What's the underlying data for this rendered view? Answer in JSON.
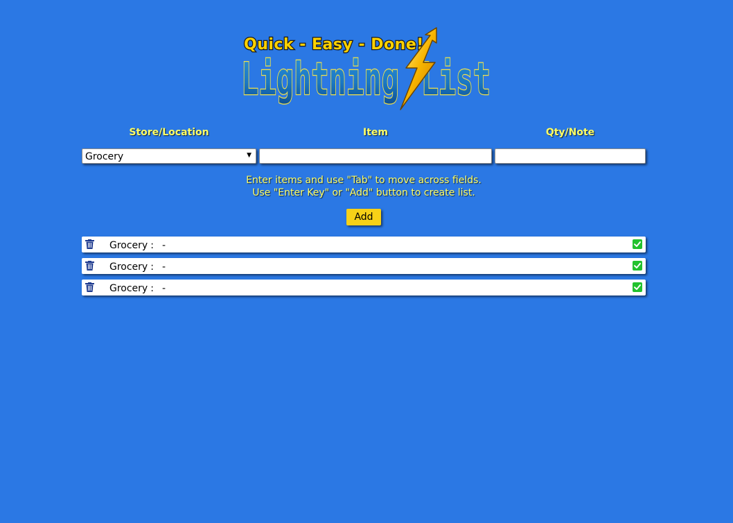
{
  "logo": {
    "tagline": "Quick - Easy - Done!",
    "name_part1": "Lightning",
    "name_part2": "List",
    "icon": "lightning-bolt-icon"
  },
  "form": {
    "headers": {
      "store": "Store/Location",
      "item": "Item",
      "qty": "Qty/Note"
    },
    "store_select": {
      "value": "Grocery",
      "icon": "triangle-down-icon"
    },
    "item_input": {
      "value": ""
    },
    "qty_input": {
      "value": ""
    },
    "instructions": {
      "line1": "Enter items and use \"Tab\" to move across fields.",
      "line2": "Use \"Enter Key\" or \"Add\" button to create list."
    },
    "add_button": "Add"
  },
  "list": {
    "items": [
      {
        "store": "Grocery",
        "separator": ":",
        "dash": "-",
        "delete_icon": "trash-icon",
        "check_icon": "check-box-icon"
      },
      {
        "store": "Grocery",
        "separator": ":",
        "dash": "-",
        "delete_icon": "trash-icon",
        "check_icon": "check-box-icon"
      },
      {
        "store": "Grocery",
        "separator": ":",
        "dash": "-",
        "delete_icon": "trash-icon",
        "check_icon": "check-box-icon"
      }
    ]
  },
  "colors": {
    "background": "#2b78e4",
    "header_text": "#ffff66",
    "add_button": "#f7d117",
    "check": "#22c22e",
    "trash": "#1f3b8f"
  }
}
